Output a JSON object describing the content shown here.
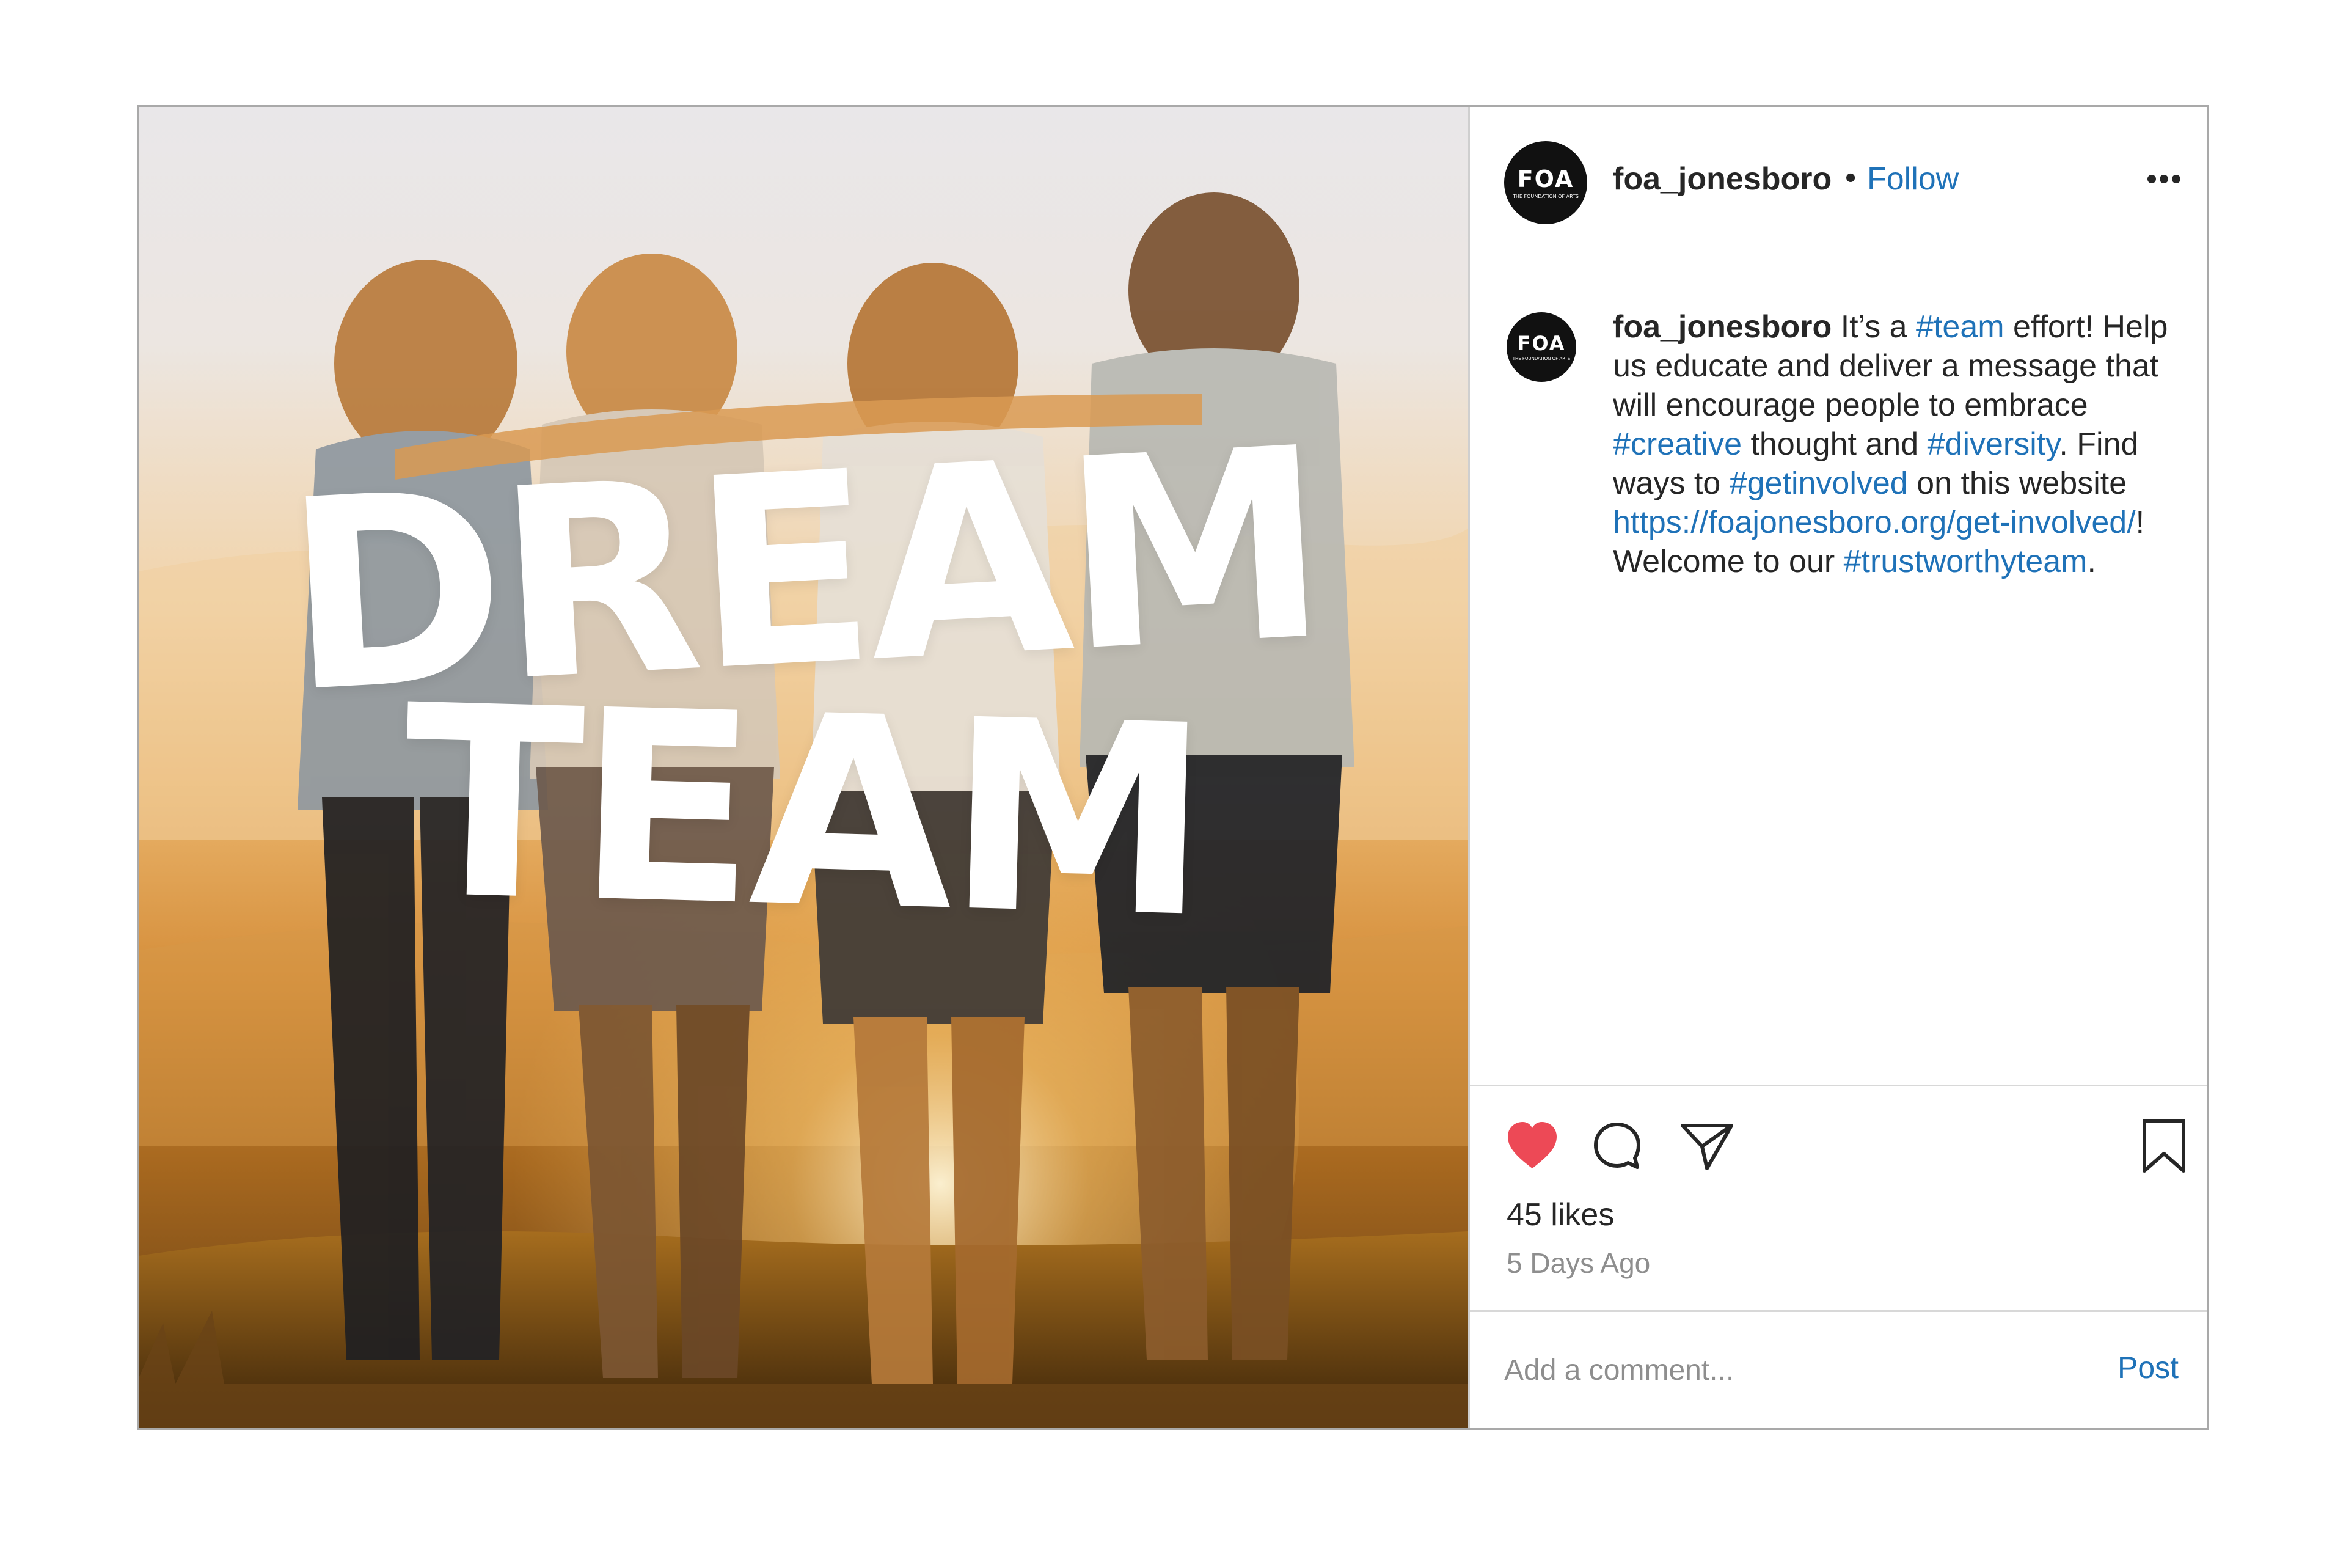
{
  "photo": {
    "headline_line1": "DREAM",
    "headline_line2": "TEAM"
  },
  "header": {
    "avatar_logo": "FOA",
    "avatar_logo_sub": "THE FOUNDATION OF ARTS",
    "username": "foa_jonesboro",
    "separator": "•",
    "follow_label": "Follow",
    "more_icon": "more-horizontal-icon"
  },
  "caption": {
    "username": "foa_jonesboro",
    "segments": [
      {
        "text": " It’s a ",
        "tag": false
      },
      {
        "text": "#team",
        "tag": true
      },
      {
        "text": " effort! Help us educate and deliver a message that will encourage people to embrace ",
        "tag": false
      },
      {
        "text": "#creative",
        "tag": true
      },
      {
        "text": " thought and ",
        "tag": false
      },
      {
        "text": "#diversity",
        "tag": true
      },
      {
        "text": ". Find ways to ",
        "tag": false
      },
      {
        "text": "#getinvolved",
        "tag": true
      },
      {
        "text": " on this website ",
        "tag": false
      },
      {
        "text": "https://foajonesboro.org/get-involved/",
        "tag": true
      },
      {
        "text": "! Welcome to our ",
        "tag": false
      },
      {
        "text": "#trustworthyteam",
        "tag": true
      },
      {
        "text": ".",
        "tag": false
      }
    ]
  },
  "actions": {
    "like_icon": "heart-filled-icon",
    "comment_icon": "comment-bubble-icon",
    "share_icon": "paper-plane-icon",
    "save_icon": "bookmark-icon",
    "likes_text": "45 likes",
    "timestamp": "5 Days Ago"
  },
  "comment": {
    "placeholder": "Add a comment...",
    "post_label": "Post"
  },
  "colors": {
    "link": "#1f72b8",
    "heart": "#ed4956",
    "text": "#262626",
    "muted": "#8e8e8e",
    "border": "#a9a9a9"
  }
}
